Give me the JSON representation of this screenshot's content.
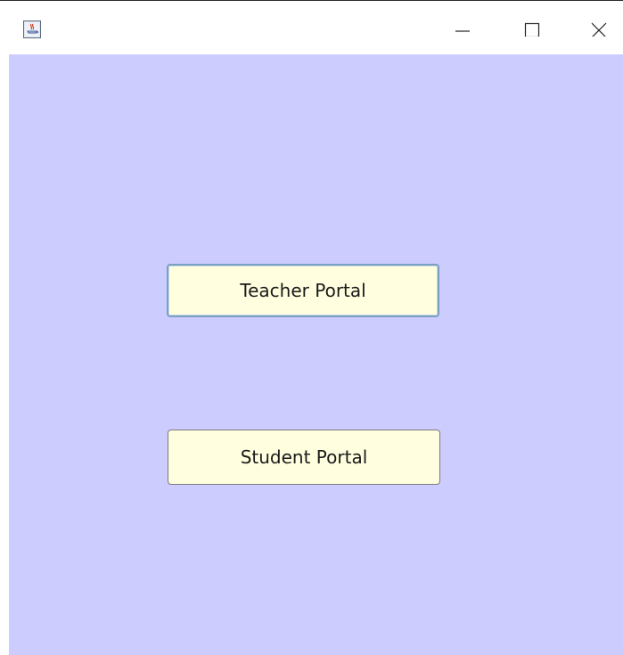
{
  "window": {
    "icon": "java-coffee-icon",
    "controls": {
      "minimize_icon": "minimize-icon",
      "maximize_icon": "maximize-icon",
      "close_icon": "close-icon"
    }
  },
  "content": {
    "background": "#ccccff",
    "teacher_button_label": "Teacher Portal",
    "student_button_label": "Student Portal"
  },
  "colors": {
    "button_fill": "#ffffe0",
    "focus_border": "#7aa0c0"
  }
}
